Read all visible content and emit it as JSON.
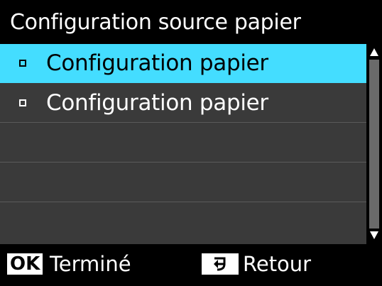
{
  "screen": {
    "title": "Configuration source papier"
  },
  "list": {
    "items": [
      {
        "label": "Configuration papier",
        "selected": true
      },
      {
        "label": "Configuration papier",
        "selected": false
      },
      {
        "label": "",
        "selected": false
      },
      {
        "label": "",
        "selected": false
      },
      {
        "label": "",
        "selected": false
      }
    ]
  },
  "scrollbar": {
    "up_icon": "triangle-up-icon",
    "down_icon": "triangle-down-icon"
  },
  "footer": {
    "ok_key": "OK",
    "ok_label": "Terminé",
    "back_icon": "return-arrow-icon",
    "back_label": "Retour"
  },
  "colors": {
    "selection": "#44ddff",
    "row_background": "#3a3a3a",
    "background": "#000000"
  }
}
